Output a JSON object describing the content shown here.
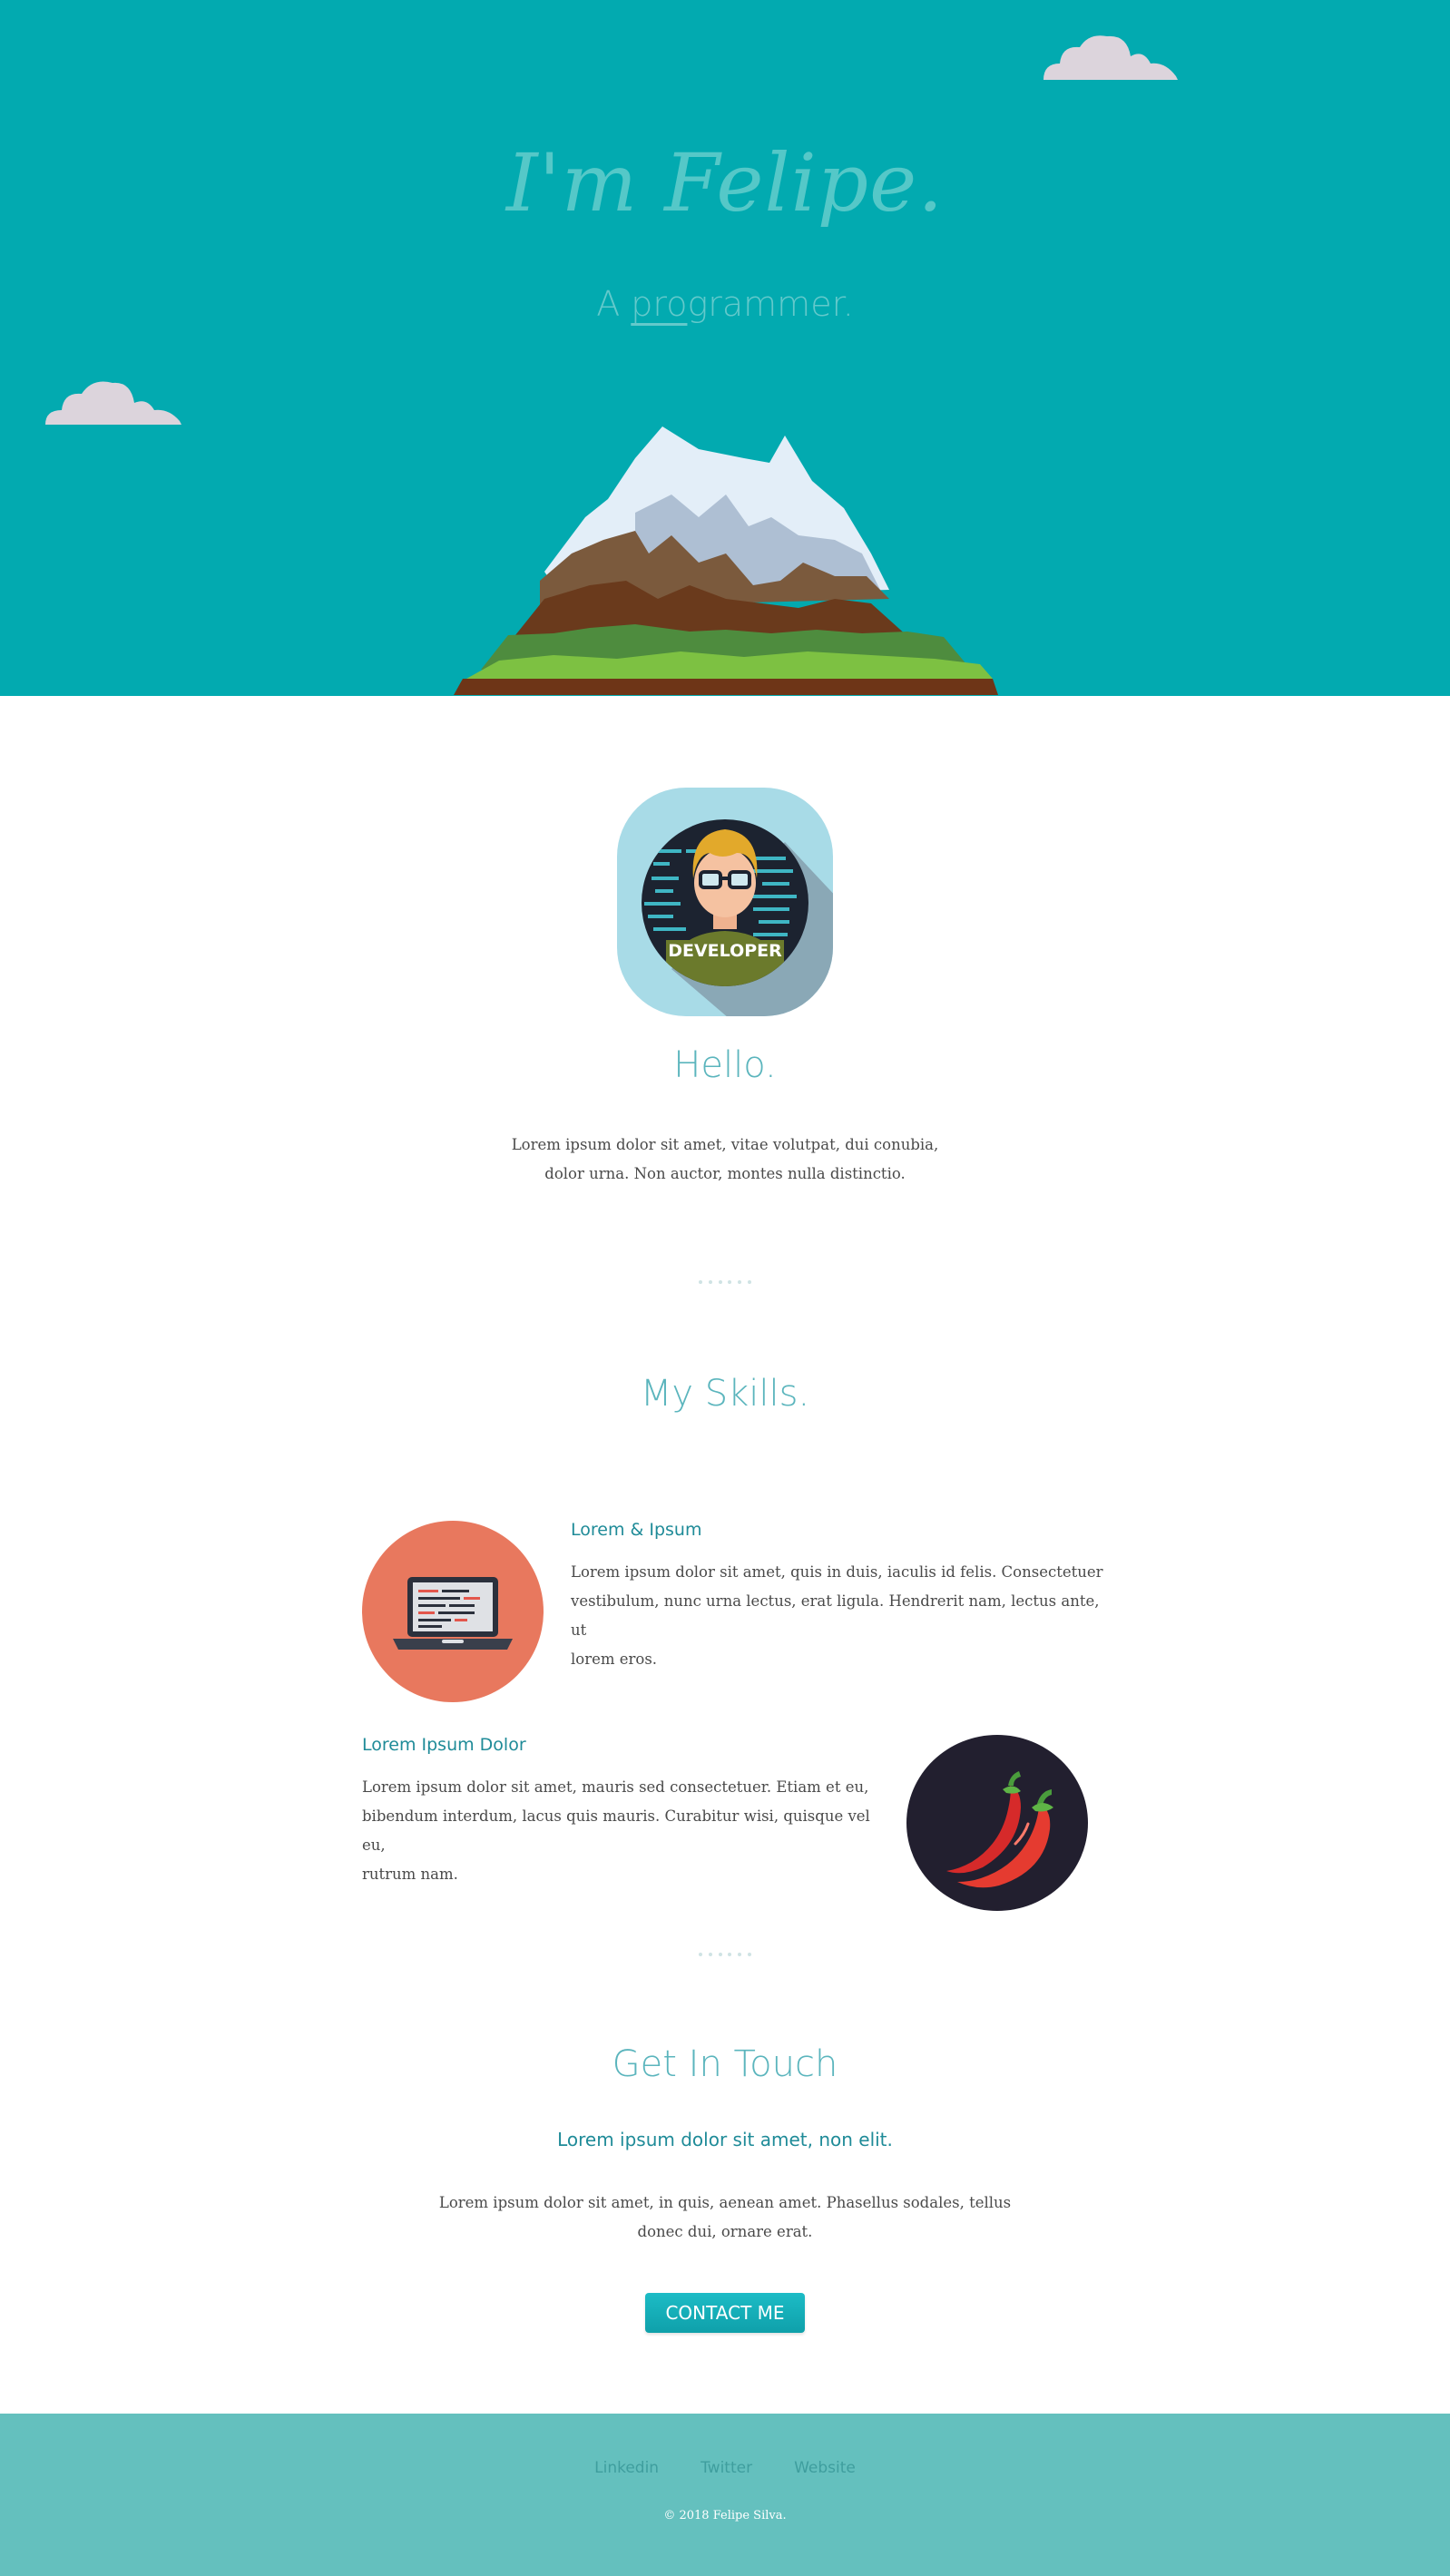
{
  "hero": {
    "title": "I'm Felipe.",
    "subtitle_prefix": "A ",
    "subtitle_typed": "pro",
    "subtitle_rest": "grammer.",
    "bg_color": "#02aab0"
  },
  "about": {
    "avatar_badge": "DEVELOPER",
    "heading": "Hello.",
    "text_line1": "Lorem ipsum dolor sit amet, vitae volutpat, dui conubia,",
    "text_line2": "dolor urna. Non auctor, montes nulla distinctio."
  },
  "skills": {
    "heading": "My Skills.",
    "items": [
      {
        "icon": "laptop-icon",
        "title": "Lorem & Ipsum",
        "line1": "Lorem ipsum dolor sit amet, quis in duis, iaculis id felis. Consectetuer",
        "line2": "vestibulum, nunc urna lectus, erat ligula. Hendrerit nam, lectus ante, ut",
        "line3": "lorem eros."
      },
      {
        "icon": "chili-pepper-icon",
        "title": "Lorem Ipsum Dolor",
        "line1": "Lorem ipsum dolor sit amet, mauris sed consectetuer. Etiam et eu,",
        "line2": "bibendum interdum, lacus quis mauris. Curabitur wisi, quisque vel eu,",
        "line3": "rutrum nam."
      }
    ]
  },
  "contact": {
    "heading": "Get In Touch",
    "subheading": "Lorem ipsum dolor sit amet, non elit.",
    "text_line1": "Lorem ipsum dolor sit amet, in quis, aenean amet. Phasellus sodales, tellus",
    "text_line2": "donec dui, ornare erat.",
    "button_label": "CONTACT ME"
  },
  "footer": {
    "links": [
      "Linkedin",
      "Twitter",
      "Website"
    ],
    "copyright": "© 2018 Felipe Silva."
  },
  "colors": {
    "accent": "#02aab0",
    "heading": "#5bb5bd",
    "skill_title": "#1f8b98",
    "footer_bg": "#64c0be",
    "laptop_circle": "#e8785e",
    "pepper_circle": "#221f2f"
  }
}
